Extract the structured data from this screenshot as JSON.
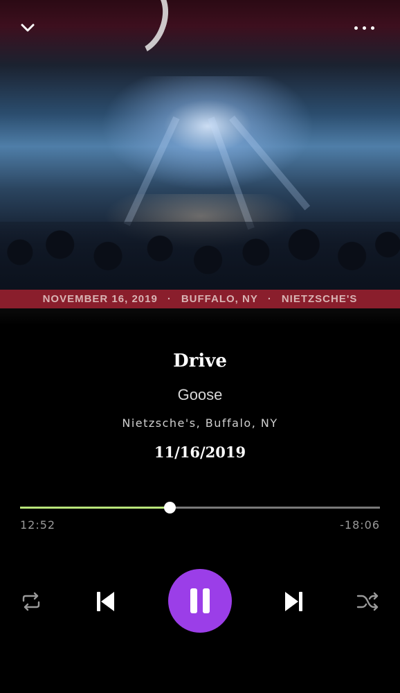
{
  "album_art": {
    "banner_date": "NOVEMBER 16, 2019",
    "banner_city": "BUFFALO, NY",
    "banner_venue": "NIETZSCHE'S",
    "banner_separator": "·"
  },
  "top_bar": {
    "collapse_icon": "chevron-down-icon",
    "more_icon": "more-horizontal-icon"
  },
  "track": {
    "title": "Drive",
    "artist": "Goose",
    "venue": "Nietzsche's, Buffalo, NY",
    "date": "11/16/2019"
  },
  "playback": {
    "elapsed": "12:52",
    "remaining": "-18:06",
    "progress_fraction": 0.415,
    "progress_color": "#b9e57a",
    "track_color": "#7a7a7a"
  },
  "controls": {
    "repeat_icon": "repeat-icon",
    "previous_icon": "skip-previous-icon",
    "play_pause_icon": "pause-icon",
    "next_icon": "skip-next-icon",
    "shuffle_icon": "shuffle-icon",
    "accent_color": "#9b3ee8"
  }
}
